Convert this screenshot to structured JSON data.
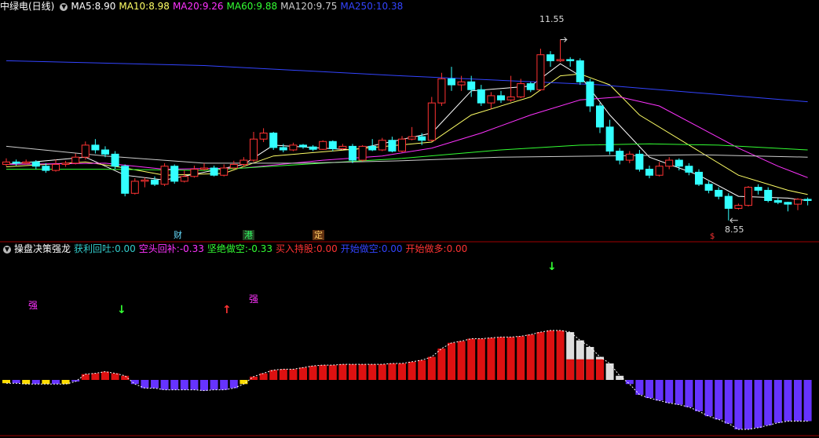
{
  "top_header": {
    "title": "中绿电(日线)",
    "ma": [
      {
        "label": "MA5:",
        "value": "8.90",
        "color": "#ffffff"
      },
      {
        "label": "MA10:",
        "value": "8.98",
        "color": "#ffff66"
      },
      {
        "label": "MA20:",
        "value": "9.26",
        "color": "#ff33ff"
      },
      {
        "label": "MA60:",
        "value": "9.88",
        "color": "#33ff33"
      },
      {
        "label": "MA120:",
        "value": "9.75",
        "color": "#cccccc"
      },
      {
        "label": "MA250:",
        "value": "10.38",
        "color": "#3344ff"
      }
    ]
  },
  "bottom_header": {
    "title": "操盘决策强龙",
    "items": [
      {
        "label": "获利回吐:",
        "value": "0.00",
        "color": "#33cccc"
      },
      {
        "label": "空头回补:",
        "value": "-0.33",
        "color": "#ff33ff"
      },
      {
        "label": "坚绝做空:",
        "value": "-0.33",
        "color": "#33ff33"
      },
      {
        "label": "买入持股:",
        "value": "0.00",
        "color": "#ff3333"
      },
      {
        "label": "开始做空:",
        "value": "0.00",
        "color": "#3344ff"
      },
      {
        "label": "开始做多:",
        "value": "0.00",
        "color": "#ff3333"
      }
    ]
  },
  "price_labels": {
    "high": "11.55",
    "low": "8.55"
  },
  "event_tags": [
    {
      "text": "财",
      "color": "#66ddff",
      "bg": "#000"
    },
    {
      "text": "港",
      "color": "#33ff66",
      "bg": "#204020"
    },
    {
      "text": "定",
      "color": "#ffcc66",
      "bg": "#603010"
    },
    {
      "text": "$",
      "color": "#ff3333",
      "bg": "#000"
    }
  ],
  "signals": [
    {
      "text": "强",
      "color": "#ff33ff"
    },
    {
      "text": "强",
      "color": "#ff33ff"
    },
    {
      "text": "↓",
      "color": "#33ff33"
    },
    {
      "text": "↑",
      "color": "#ff3333"
    },
    {
      "text": "↓",
      "color": "#33ff33"
    }
  ],
  "chart_data": {
    "type": "candlestick",
    "price_axis": [
      8.3,
      12.0
    ],
    "candles": [
      [
        9.48,
        9.52,
        9.58,
        9.45
      ],
      [
        9.52,
        9.5,
        9.56,
        9.46
      ],
      [
        9.5,
        9.52,
        9.56,
        9.48
      ],
      [
        9.52,
        9.45,
        9.55,
        9.4
      ],
      [
        9.45,
        9.38,
        9.5,
        9.34
      ],
      [
        9.38,
        9.48,
        9.56,
        9.36
      ],
      [
        9.48,
        9.5,
        9.54,
        9.44
      ],
      [
        9.5,
        9.6,
        9.66,
        9.48
      ],
      [
        9.6,
        9.8,
        9.86,
        9.56
      ],
      [
        9.8,
        9.72,
        9.9,
        9.66
      ],
      [
        9.72,
        9.65,
        9.78,
        9.6
      ],
      [
        9.65,
        9.45,
        9.7,
        9.4
      ],
      [
        9.45,
        9.0,
        9.48,
        8.95
      ],
      [
        9.0,
        9.2,
        9.25,
        8.98
      ],
      [
        9.2,
        9.22,
        9.26,
        9.1
      ],
      [
        9.22,
        9.15,
        9.28,
        9.12
      ],
      [
        9.15,
        9.45,
        9.5,
        9.12
      ],
      [
        9.45,
        9.2,
        9.48,
        9.16
      ],
      [
        9.2,
        9.28,
        9.38,
        9.18
      ],
      [
        9.28,
        9.4,
        9.46,
        9.26
      ],
      [
        9.4,
        9.42,
        9.5,
        9.38
      ],
      [
        9.42,
        9.3,
        9.46,
        9.28
      ],
      [
        9.3,
        9.42,
        9.48,
        9.28
      ],
      [
        9.42,
        9.48,
        9.54,
        9.4
      ],
      [
        9.48,
        9.55,
        9.6,
        9.44
      ],
      [
        9.55,
        9.9,
        10.02,
        9.52
      ],
      [
        9.9,
        10.0,
        10.08,
        9.85
      ],
      [
        10.0,
        9.76,
        10.02,
        9.72
      ],
      [
        9.76,
        9.72,
        9.82,
        9.68
      ],
      [
        9.72,
        9.8,
        9.84,
        9.7
      ],
      [
        9.8,
        9.77,
        9.82,
        9.74
      ],
      [
        9.77,
        9.73,
        9.8,
        9.7
      ],
      [
        9.73,
        9.86,
        9.88,
        9.72
      ],
      [
        9.86,
        9.74,
        9.88,
        9.7
      ],
      [
        9.74,
        9.78,
        9.82,
        9.72
      ],
      [
        9.78,
        9.55,
        9.82,
        9.5
      ],
      [
        9.55,
        9.78,
        9.8,
        9.53
      ],
      [
        9.78,
        9.72,
        9.9,
        9.7
      ],
      [
        9.72,
        9.88,
        9.92,
        9.7
      ],
      [
        9.88,
        9.7,
        9.94,
        9.68
      ],
      [
        9.7,
        9.9,
        9.95,
        9.68
      ],
      [
        9.9,
        9.94,
        10.1,
        9.88
      ],
      [
        9.94,
        9.88,
        10.0,
        9.8
      ],
      [
        9.88,
        10.5,
        10.6,
        9.86
      ],
      [
        10.5,
        10.9,
        11.0,
        10.45
      ],
      [
        10.9,
        10.8,
        11.1,
        10.7
      ],
      [
        10.8,
        10.85,
        10.95,
        10.7
      ],
      [
        10.85,
        10.72,
        10.95,
        10.6
      ],
      [
        10.72,
        10.5,
        10.8,
        10.45
      ],
      [
        10.5,
        10.62,
        10.68,
        10.4
      ],
      [
        10.62,
        10.55,
        10.7,
        10.5
      ],
      [
        10.55,
        10.6,
        10.95,
        10.52
      ],
      [
        10.6,
        10.82,
        10.9,
        10.58
      ],
      [
        10.82,
        10.72,
        10.85,
        10.68
      ],
      [
        10.72,
        11.3,
        11.4,
        10.7
      ],
      [
        11.3,
        11.2,
        11.36,
        11.1
      ],
      [
        11.2,
        11.22,
        11.55,
        11.18
      ],
      [
        11.22,
        11.2,
        11.26,
        11.1
      ],
      [
        11.2,
        10.85,
        11.24,
        10.8
      ],
      [
        10.85,
        10.45,
        10.9,
        10.35
      ],
      [
        10.45,
        10.1,
        10.5,
        10.0
      ],
      [
        10.1,
        9.7,
        10.22,
        9.64
      ],
      [
        9.7,
        9.55,
        9.75,
        9.48
      ],
      [
        9.55,
        9.65,
        9.7,
        9.5
      ],
      [
        9.65,
        9.4,
        9.72,
        9.36
      ],
      [
        9.4,
        9.3,
        9.46,
        9.25
      ],
      [
        9.3,
        9.45,
        9.52,
        9.28
      ],
      [
        9.45,
        9.55,
        9.6,
        9.4
      ],
      [
        9.55,
        9.45,
        9.58,
        9.38
      ],
      [
        9.45,
        9.35,
        9.5,
        9.3
      ],
      [
        9.35,
        9.15,
        9.4,
        9.12
      ],
      [
        9.15,
        9.05,
        9.2,
        9.0
      ],
      [
        9.05,
        8.95,
        9.1,
        8.9
      ],
      [
        8.95,
        8.75,
        9.0,
        8.55
      ],
      [
        8.75,
        8.8,
        8.83,
        8.73
      ],
      [
        8.8,
        9.1,
        9.12,
        8.78
      ],
      [
        9.1,
        9.05,
        9.15,
        8.98
      ],
      [
        9.05,
        8.88,
        9.1,
        8.85
      ],
      [
        8.88,
        8.85,
        8.92,
        8.82
      ],
      [
        8.85,
        8.82,
        8.86,
        8.7
      ],
      [
        8.82,
        8.9,
        8.92,
        8.72
      ],
      [
        8.9,
        8.88,
        8.93,
        8.8
      ]
    ],
    "ma_series": [
      {
        "name": "MA5",
        "color": "#ffffff",
        "points": [
          [
            0,
            9.48
          ],
          [
            8,
            9.6
          ],
          [
            12,
            9.3
          ],
          [
            16,
            9.22
          ],
          [
            24,
            9.48
          ],
          [
            27,
            9.8
          ],
          [
            35,
            9.72
          ],
          [
            43,
            10.0
          ],
          [
            47,
            10.7
          ],
          [
            53,
            10.78
          ],
          [
            56,
            11.15
          ],
          [
            58,
            10.95
          ],
          [
            61,
            10.3
          ],
          [
            65,
            9.6
          ],
          [
            70,
            9.3
          ],
          [
            74,
            8.95
          ],
          [
            79,
            8.92
          ],
          [
            81,
            8.88
          ]
        ]
      },
      {
        "name": "MA10",
        "color": "#ffff66",
        "points": [
          [
            0,
            9.44
          ],
          [
            8,
            9.52
          ],
          [
            12,
            9.42
          ],
          [
            16,
            9.3
          ],
          [
            22,
            9.33
          ],
          [
            27,
            9.62
          ],
          [
            35,
            9.73
          ],
          [
            43,
            9.85
          ],
          [
            47,
            10.3
          ],
          [
            53,
            10.6
          ],
          [
            56,
            10.95
          ],
          [
            58,
            10.98
          ],
          [
            61,
            10.8
          ],
          [
            64,
            10.3
          ],
          [
            70,
            9.7
          ],
          [
            74,
            9.3
          ],
          [
            79,
            9.05
          ],
          [
            81,
            8.98
          ]
        ]
      },
      {
        "name": "MA20",
        "color": "#ff33ff",
        "points": [
          [
            0,
            9.48
          ],
          [
            10,
            9.5
          ],
          [
            16,
            9.4
          ],
          [
            24,
            9.42
          ],
          [
            32,
            9.55
          ],
          [
            38,
            9.62
          ],
          [
            43,
            9.75
          ],
          [
            48,
            10.0
          ],
          [
            53,
            10.3
          ],
          [
            58,
            10.55
          ],
          [
            62,
            10.6
          ],
          [
            66,
            10.45
          ],
          [
            70,
            10.1
          ],
          [
            74,
            9.75
          ],
          [
            78,
            9.45
          ],
          [
            81,
            9.26
          ]
        ]
      },
      {
        "name": "MA60",
        "color": "#33ff33",
        "points": [
          [
            0,
            9.4
          ],
          [
            10,
            9.4
          ],
          [
            20,
            9.38
          ],
          [
            30,
            9.48
          ],
          [
            40,
            9.58
          ],
          [
            50,
            9.72
          ],
          [
            58,
            9.8
          ],
          [
            65,
            9.82
          ],
          [
            72,
            9.8
          ],
          [
            81,
            9.72
          ]
        ]
      },
      {
        "name": "MA120",
        "color": "#cccccc",
        "points": [
          [
            0,
            9.78
          ],
          [
            10,
            9.62
          ],
          [
            20,
            9.5
          ],
          [
            30,
            9.5
          ],
          [
            40,
            9.54
          ],
          [
            50,
            9.6
          ],
          [
            60,
            9.62
          ],
          [
            70,
            9.64
          ],
          [
            81,
            9.6
          ]
        ]
      },
      {
        "name": "MA250",
        "color": "#3344ff",
        "points": [
          [
            0,
            11.2
          ],
          [
            20,
            11.12
          ],
          [
            40,
            10.95
          ],
          [
            60,
            10.8
          ],
          [
            81,
            10.52
          ]
        ]
      }
    ],
    "indicator_values": [
      -0.04,
      -0.04,
      -0.05,
      -0.05,
      -0.05,
      -0.05,
      -0.05,
      -0.02,
      0.07,
      0.08,
      0.1,
      0.08,
      0.05,
      -0.05,
      -0.1,
      -0.1,
      -0.12,
      -0.12,
      -0.12,
      -0.12,
      -0.13,
      -0.12,
      -0.12,
      -0.1,
      -0.05,
      0.04,
      0.08,
      0.12,
      0.13,
      0.13,
      0.15,
      0.17,
      0.18,
      0.18,
      0.19,
      0.19,
      0.19,
      0.19,
      0.19,
      0.2,
      0.2,
      0.22,
      0.24,
      0.28,
      0.38,
      0.45,
      0.47,
      0.5,
      0.5,
      0.51,
      0.52,
      0.52,
      0.53,
      0.55,
      0.58,
      0.6,
      0.6,
      0.58,
      0.48,
      0.4,
      0.28,
      0.2,
      0.05,
      -0.05,
      -0.18,
      -0.22,
      -0.25,
      -0.28,
      -0.3,
      -0.33,
      -0.38,
      -0.44,
      -0.48,
      -0.53,
      -0.6,
      -0.6,
      -0.58,
      -0.55,
      -0.52,
      -0.5,
      -0.5,
      -0.5
    ]
  }
}
